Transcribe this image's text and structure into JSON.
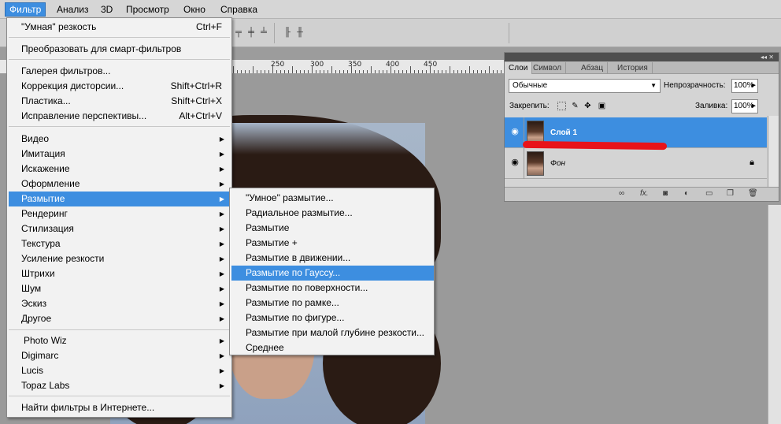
{
  "menubar": {
    "items": [
      "Фильтр",
      "Анализ",
      "3D",
      "Просмотр",
      "Окно",
      "Справка"
    ]
  },
  "filter_menu": {
    "items": [
      {
        "label": "\"Умная\" резкость",
        "shortcut": "Ctrl+F"
      },
      {
        "label": "Преобразовать для смарт-фильтров"
      },
      {
        "label": "Галерея фильтров..."
      },
      {
        "label": "Коррекция дисторсии...",
        "shortcut": "Shift+Ctrl+R"
      },
      {
        "label": "Пластика...",
        "shortcut": "Shift+Ctrl+X"
      },
      {
        "label": "Исправление перспективы...",
        "shortcut": "Alt+Ctrl+V"
      },
      {
        "label": "Видео"
      },
      {
        "label": "Имитация"
      },
      {
        "label": "Искажение"
      },
      {
        "label": "Оформление"
      },
      {
        "label": "Размытие"
      },
      {
        "label": "Рендеринг"
      },
      {
        "label": "Стилизация"
      },
      {
        "label": "Текстура"
      },
      {
        "label": "Усиление резкости"
      },
      {
        "label": "Штрихи"
      },
      {
        "label": "Шум"
      },
      {
        "label": "Эскиз"
      },
      {
        "label": "Другое"
      },
      {
        "label": "Photo Wiz"
      },
      {
        "label": "Digimarc"
      },
      {
        "label": "Lucis"
      },
      {
        "label": "Topaz Labs"
      },
      {
        "label": "Найти фильтры в Интернете..."
      }
    ]
  },
  "blur_menu": {
    "items": [
      "\"Умное\" размытие...",
      "Радиальное размытие...",
      "Размытие",
      "Размытие +",
      "Размытие в движении...",
      "Размытие по Гауссу...",
      "Размытие по поверхности...",
      "Размытие по рамке...",
      "Размытие по фигуре...",
      "Размытие при малой глубине резкости...",
      "Среднее"
    ]
  },
  "ruler": {
    "labels": [
      "250",
      "300",
      "350",
      "400",
      "450"
    ]
  },
  "layers_panel": {
    "tabs": [
      "Слои",
      "Символ",
      "Абзац",
      "История"
    ],
    "blend_mode": "Обычные",
    "opacity_label": "Непрозрачность:",
    "opacity_value": "100%",
    "lock_label": "Закрепить:",
    "fill_label": "Заливка:",
    "fill_value": "100%",
    "layers": [
      {
        "name": "Слой 1",
        "selected": true
      },
      {
        "name": "Фон",
        "selected": false
      }
    ]
  },
  "colors": {
    "highlight": "#3d8ee0",
    "red_mark": "#e8131a"
  }
}
